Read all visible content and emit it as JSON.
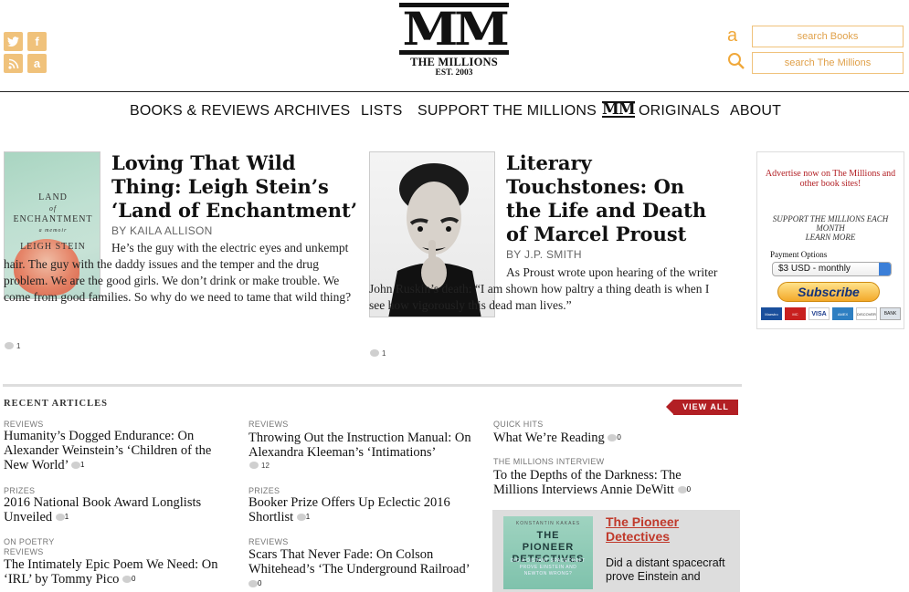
{
  "social": {
    "twitter": "t",
    "facebook": "f",
    "rss": "rss",
    "amazon": "a"
  },
  "logo": {
    "mark": "MM",
    "name": "THE MILLIONS",
    "est": "EST. 2003"
  },
  "search": {
    "books": "search Books",
    "site": "search The Millions",
    "amazon_glyph": "a",
    "magnifier_glyph": "⚲"
  },
  "nav": [
    "BOOKS & REVIEWS",
    "ARCHIVES",
    "LISTS",
    "SUPPORT THE MILLIONS",
    "ORIGINALS",
    "ABOUT"
  ],
  "nav_originals_mark": "MM",
  "features": [
    {
      "title": "Loving That Wild Thing: Leigh Stein’s ‘Land of Enchantment’",
      "byline": "BY KAILA ALLISON",
      "excerpt": "He’s the guy with the electric eyes and unkempt hair. The guy with the daddy issues and the temper and the drug problem. We are the good girls. We don’t drink or make trouble. We come from good families. So why do we need to tame that wild thing?",
      "comments": "1",
      "cover": {
        "line1": "LAND",
        "line2": "of",
        "line3": "ENCHANTMENT",
        "line4": "a memoir",
        "line5": "LEIGH STEIN"
      }
    },
    {
      "title": "Literary Touchstones: On the Life and Death of Marcel Proust",
      "byline": "BY J.P. SMITH",
      "excerpt": "As Proust wrote upon hearing of the writer John Ruskin’s death: “I am shown how paltry a thing death is when I see how vigorously this dead man lives.”",
      "comments": "1"
    }
  ],
  "ad": {
    "headline": "Advertise now on The Millions and other book sites!",
    "support": "SUPPORT THE MILLIONS EACH MONTH",
    "learn": "LEARN MORE",
    "payment_label": "Payment Options",
    "payment_value": "$3 USD - monthly",
    "subscribe": "Subscribe",
    "cards": [
      "Maestro",
      "MC",
      "VISA",
      "AMEX",
      "DISCOVER",
      "BANK"
    ]
  },
  "recent": {
    "heading": "RECENT ARTICLES",
    "view_all": "VIEW ALL",
    "col1": [
      {
        "cats": [
          "REVIEWS"
        ],
        "title": "Humanity’s Dogged Endurance: On Alexander Weinstein’s ‘Children of the New World’",
        "comments": "1"
      },
      {
        "cats": [
          "PRIZES"
        ],
        "title": "2016 National Book Award Longlists Unveiled",
        "comments": "1"
      },
      {
        "cats": [
          "ON POETRY",
          "REVIEWS"
        ],
        "title": "The Intimately Epic Poem We Need: On ‘IRL’ by Tommy Pico",
        "comments": "0"
      }
    ],
    "col2": [
      {
        "cats": [
          "REVIEWS"
        ],
        "title": "Throwing Out the Instruction Manual: On Alexandra Kleeman’s ‘Intimations’",
        "comments": "12"
      },
      {
        "cats": [
          "PRIZES"
        ],
        "title": "Booker Prize Offers Up Eclectic 2016 Shortlist",
        "comments": "1"
      },
      {
        "cats": [
          "REVIEWS"
        ],
        "title": "Scars That Never Fade: On Colson Whitehead’s ‘The Underground Railroad’",
        "comments": "0"
      }
    ],
    "col3": [
      {
        "cats": [
          "QUICK HITS"
        ],
        "title": "What We’re Reading",
        "comments": "0"
      },
      {
        "cats": [
          "THE MILLIONS INTERVIEW"
        ],
        "title": "To the Depths of the Darkness: The Millions Interviews Annie DeWitt",
        "comments": "0"
      }
    ]
  },
  "promo": {
    "title": "The Pioneer Detectives",
    "excerpt": "Did a distant spacecraft prove Einstein and",
    "book_author": "KONSTANTIN KAKAES",
    "book_title": "THE PIONEER DETECTIVES",
    "book_sub": "DID A DISTANT SPACECRAFT PROVE EINSTEIN AND NEWTON WRONG?"
  },
  "colors": {
    "accent": "#f0c27b",
    "view_all": "#b21f24",
    "promo_link": "#c0392b"
  }
}
